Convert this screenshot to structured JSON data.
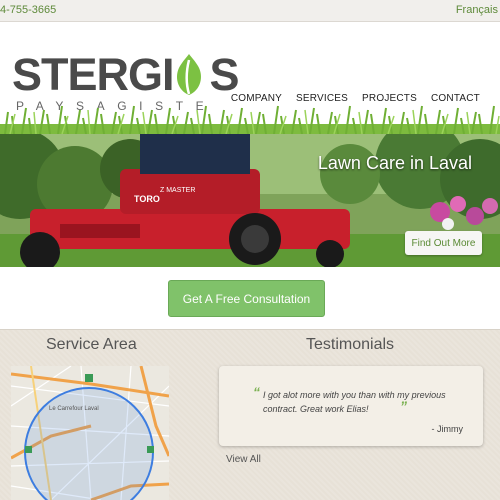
{
  "topbar": {
    "phone": "4-755-3665",
    "language": "Français"
  },
  "header": {
    "logo_text": "STERGI",
    "logo_text_end": "S",
    "tagline": "PAYSAGISTE",
    "nav": [
      "COMPANY",
      "SERVICES",
      "PROJECTS",
      "CONTACT"
    ]
  },
  "hero": {
    "title": "Lawn Care in Laval",
    "button": "Find Out More",
    "mower_brand": "TORO",
    "mower_model": "Z MASTER"
  },
  "consultation": {
    "button": "Get A Free Consultation"
  },
  "service_area": {
    "title": "Service Area",
    "map_label": "Le Carrefour Laval"
  },
  "testimonials": {
    "title": "Testimonials",
    "quote": "I got alot more with you than with my previous contract. Great work Elias!",
    "author": "- Jimmy",
    "view_all": "View All"
  },
  "colors": {
    "accent_green": "#80c26a",
    "link_green": "#5e8a3a",
    "logo_gray": "#4a4a4a"
  }
}
